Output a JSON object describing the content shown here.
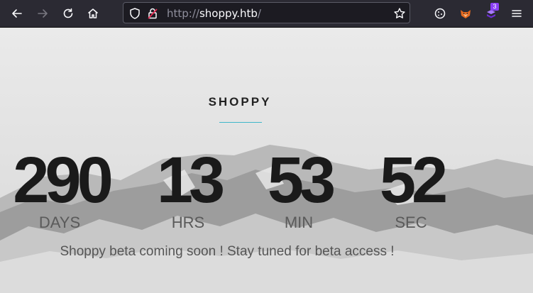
{
  "browser": {
    "url_scheme": "http://",
    "url_host": "shoppy.htb",
    "url_path": "/",
    "extension_badge": "3"
  },
  "page": {
    "brand": "SHOPPY",
    "countdown": [
      {
        "value": "290",
        "unit": "DAYS"
      },
      {
        "value": "13",
        "unit": "HRS"
      },
      {
        "value": "53",
        "unit": "MIN"
      },
      {
        "value": "52",
        "unit": "SEC"
      }
    ],
    "message": "Shoppy beta coming soon ! Stay tuned for beta access !"
  },
  "colors": {
    "accent_line": "#3fb7c9",
    "toolbar_bg": "#2b2a33"
  }
}
